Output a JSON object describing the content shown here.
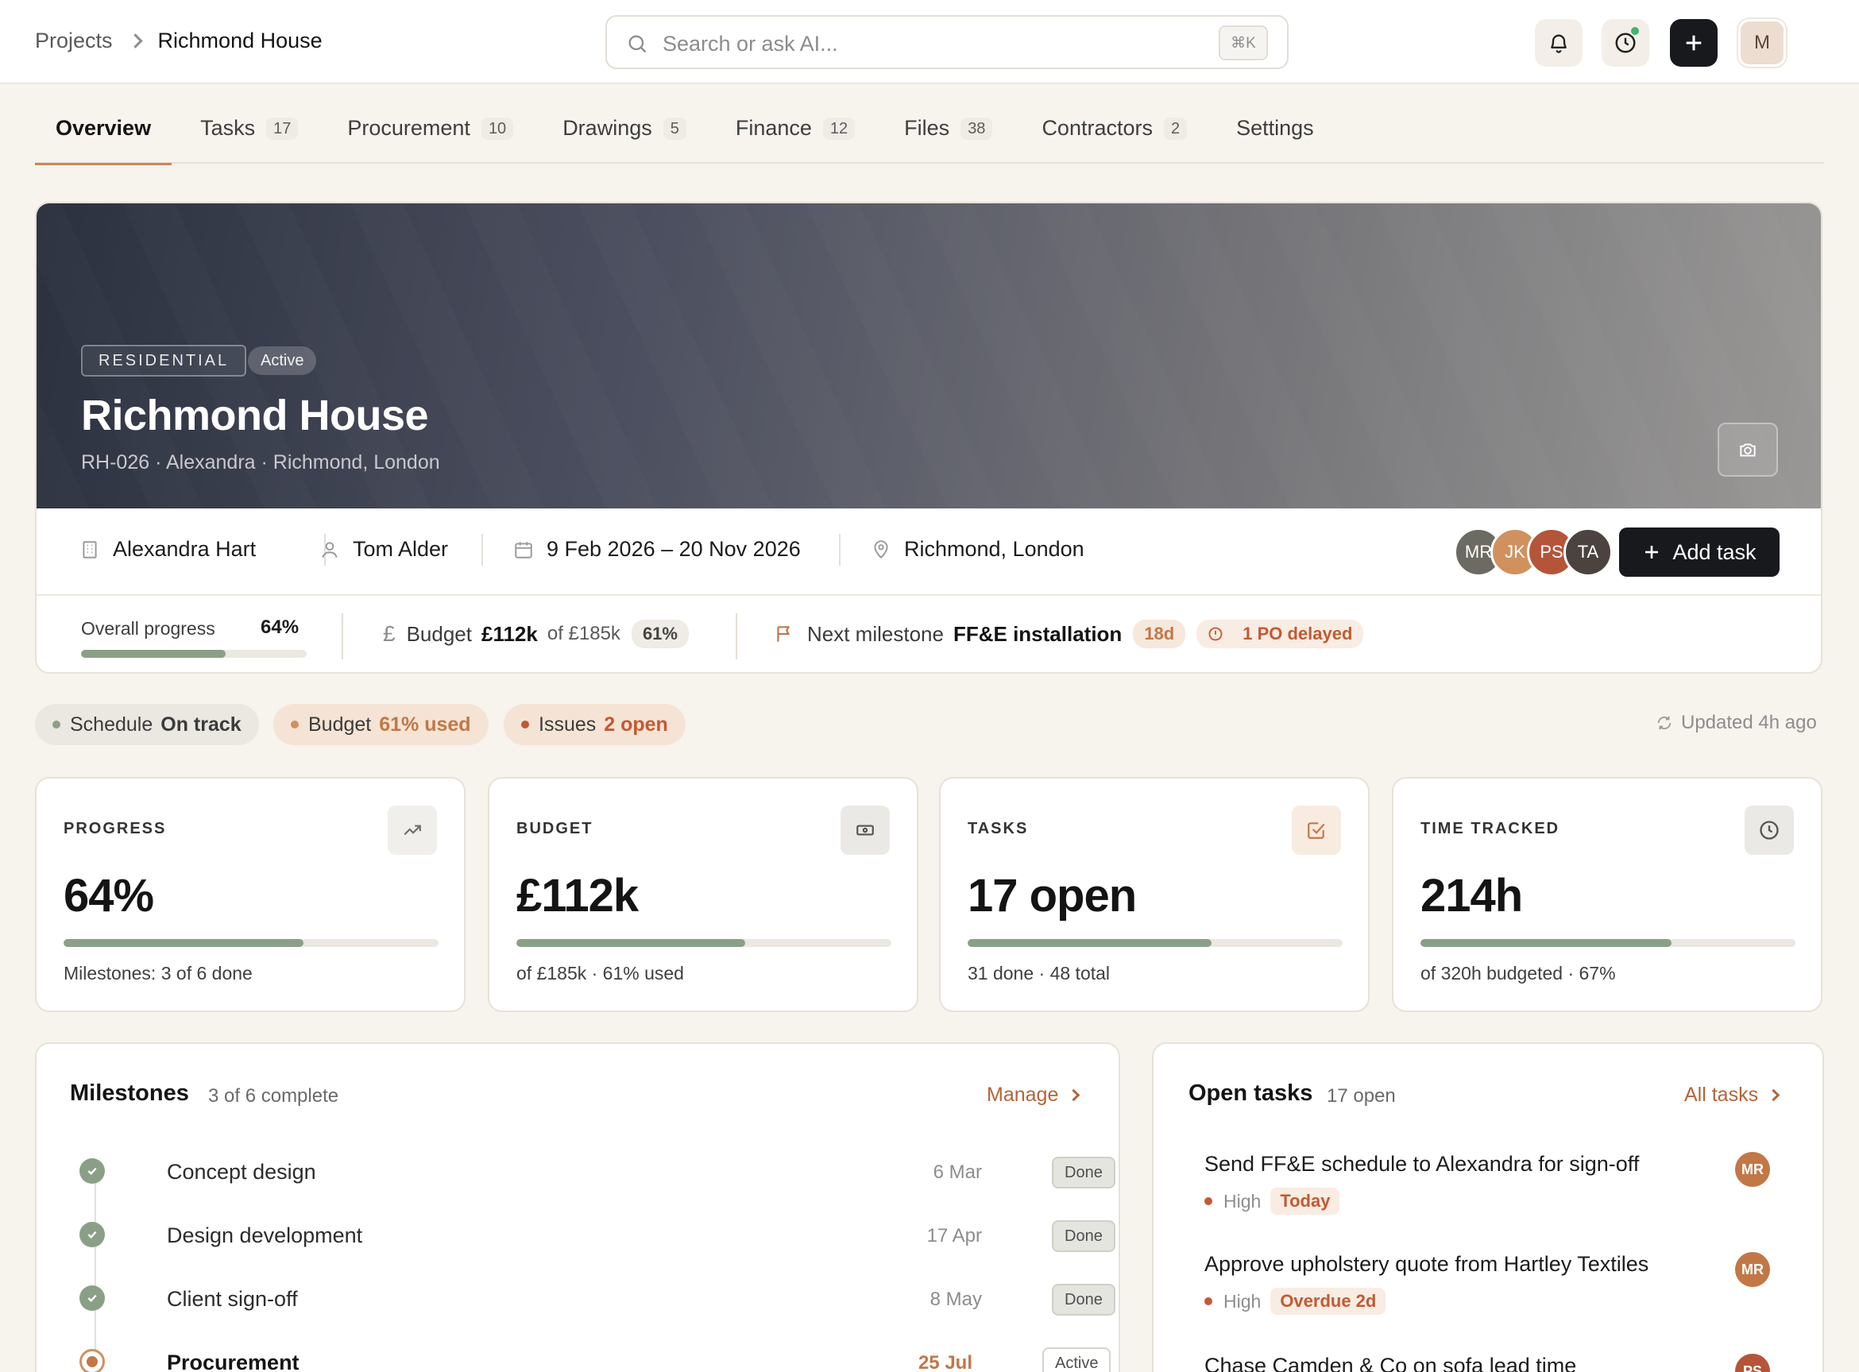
{
  "breadcrumb": {
    "parent": "Projects",
    "current": "Richmond House"
  },
  "search": {
    "placeholder": "Search or ask AI...",
    "shortcut": "⌘K"
  },
  "user": {
    "initial": "M"
  },
  "tabs": [
    {
      "label": "Overview",
      "count": null
    },
    {
      "label": "Tasks",
      "count": "17"
    },
    {
      "label": "Procurement",
      "count": "10"
    },
    {
      "label": "Drawings",
      "count": "5"
    },
    {
      "label": "Finance",
      "count": "12"
    },
    {
      "label": "Files",
      "count": "38"
    },
    {
      "label": "Contractors",
      "count": "2"
    },
    {
      "label": "Settings",
      "count": null
    }
  ],
  "hero": {
    "type_tag": "RESIDENTIAL",
    "status_tag": "Active",
    "title": "Richmond House",
    "subtitle": "RH-026 · Alexandra · Richmond, London"
  },
  "meta": {
    "client": "Alexandra Hart",
    "manager": "Tom Alder",
    "dates": "9 Feb 2026 – 20 Nov 2026",
    "location": "Richmond, London",
    "team": [
      {
        "initials": "MR",
        "color": "#6b6b62"
      },
      {
        "initials": "JK",
        "color": "#d0915e"
      },
      {
        "initials": "PS",
        "color": "#b4553a"
      },
      {
        "initials": "TA",
        "color": "#4b4340"
      }
    ],
    "add_task_label": "Add task"
  },
  "progress_row": {
    "progress_label": "Overall progress",
    "progress_value": "64%",
    "progress_fraction": 0.64,
    "budget_label": "Budget",
    "budget_spent": "£112k",
    "budget_total": "of £185k",
    "budget_pct": "61%",
    "milestone_label": "Next milestone",
    "milestone_name": "FF&E installation",
    "milestone_days": "18d",
    "po_delayed": "1 PO delayed"
  },
  "status": {
    "schedule": {
      "label": "Schedule",
      "value": "On track"
    },
    "budget": {
      "label": "Budget",
      "value": "61% used"
    },
    "issues": {
      "label": "Issues",
      "value": "2 open"
    },
    "updated": "Updated 4h ago"
  },
  "kpis": [
    {
      "label": "PROGRESS",
      "value": "64%",
      "sub": "Milestones: 3 of 6 done",
      "fraction": 0.64,
      "icon": "trending-up-icon"
    },
    {
      "label": "BUDGET",
      "value": "£112k",
      "sub": "of £185k · 61% used",
      "fraction": 0.61,
      "icon": "banknote-icon"
    },
    {
      "label": "TASKS",
      "value": "17 open",
      "sub": "31 done · 48 total",
      "fraction": 0.65,
      "icon": "check-square-icon"
    },
    {
      "label": "TIME TRACKED",
      "value": "214h",
      "sub": "of 320h budgeted · 67%",
      "fraction": 0.67,
      "icon": "clock-icon"
    }
  ],
  "milestones": {
    "title": "Milestones",
    "subtitle": "3 of 6 complete",
    "link": "Manage",
    "items": [
      {
        "name": "Concept design",
        "date": "6 Mar",
        "status": "Done"
      },
      {
        "name": "Design development",
        "date": "17 Apr",
        "status": "Done"
      },
      {
        "name": "Client sign-off",
        "date": "8 May",
        "status": "Done"
      },
      {
        "name": "Procurement",
        "date": "25 Jul",
        "status": "Active"
      }
    ]
  },
  "open_tasks": {
    "title": "Open tasks",
    "subtitle": "17 open",
    "link": "All tasks",
    "items": [
      {
        "name": "Send FF&E schedule to Alexandra for sign-off",
        "priority": "High",
        "due": "Today",
        "assignee": "MR"
      },
      {
        "name": "Approve upholstery quote from Hartley Textiles",
        "priority": "High",
        "due": "Overdue 2d",
        "assignee": "MR"
      },
      {
        "name": "Chase Camden & Co on sofa lead time",
        "priority": "",
        "due": "",
        "assignee": "PS"
      }
    ]
  },
  "colors": {
    "accent": "#c27747",
    "progress": "#8aa086",
    "dark": "#17191d"
  }
}
